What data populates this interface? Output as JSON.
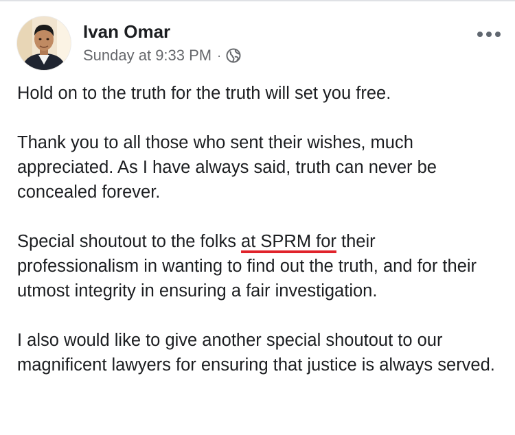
{
  "post": {
    "author_name": "Ivan Omar",
    "timestamp": "Sunday at 9:33 PM",
    "separator": "·",
    "privacy_icon": "globe-icon",
    "more_icon": "more-options-icon",
    "paragraphs": [
      {
        "text": "Hold on to the truth for the truth will set you free."
      },
      {
        "text": "Thank you to all those who sent their wishes, much appreciated. As I have always said, truth can never be concealed forever."
      },
      {
        "before": "Special shoutout to the folks ",
        "highlight": "at SPRM for",
        "after": " their professionalism in wanting to find out the truth, and for their utmost integrity in ensuring a fair investigation."
      },
      {
        "text": "I also would like to give another special shoutout to our magnificent lawyers for ensuring that justice is always served."
      }
    ]
  },
  "colors": {
    "text_primary": "#1c1e21",
    "text_secondary": "#65676b",
    "underline_mark": "#e0232b"
  }
}
